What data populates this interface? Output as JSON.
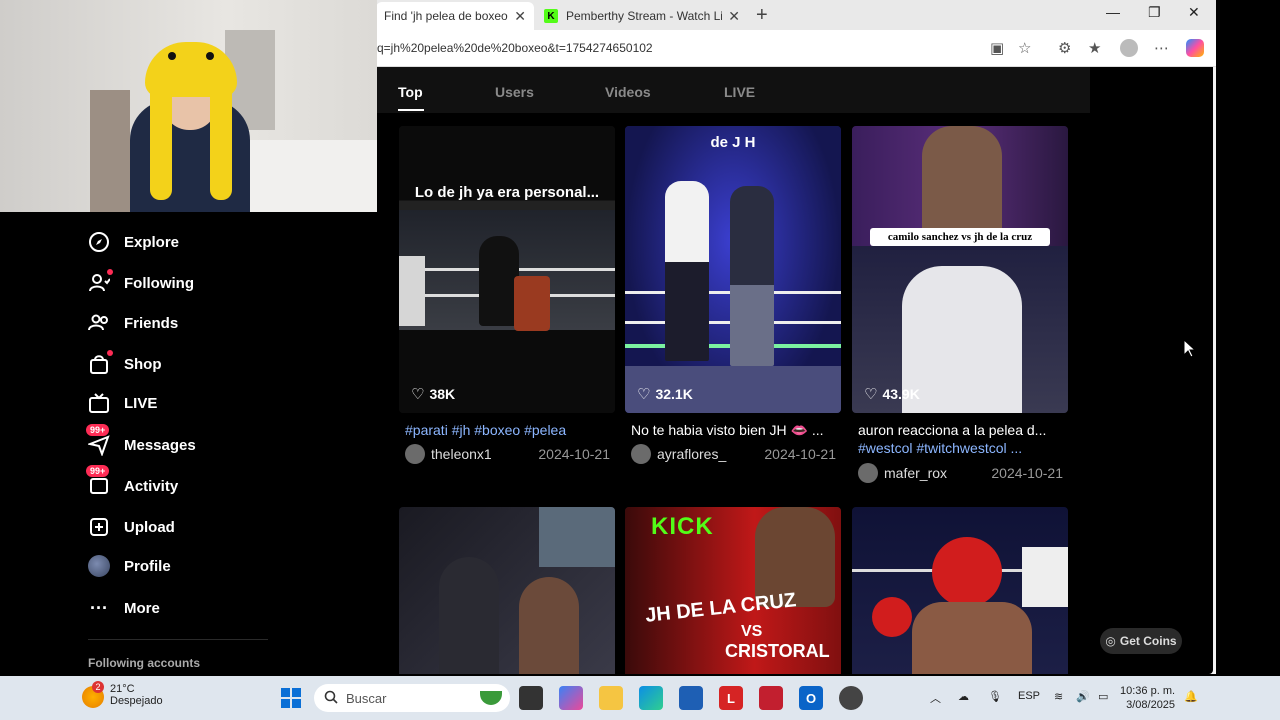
{
  "browser": {
    "tabs": [
      {
        "label": "Find 'jh pelea de boxeo' on"
      },
      {
        "label": "Pemberthy Stream - Watch Live o"
      }
    ],
    "url": "q=jh%20pelea%20de%20boxeo&t=1754274650102"
  },
  "sidebar": {
    "items": [
      {
        "label": "Explore",
        "icon": "compass-icon"
      },
      {
        "label": "Following",
        "icon": "following-icon"
      },
      {
        "label": "Friends",
        "icon": "friends-icon"
      },
      {
        "label": "Shop",
        "icon": "shop-icon"
      },
      {
        "label": "LIVE",
        "icon": "live-tv-icon"
      },
      {
        "label": "Messages",
        "icon": "messages-icon",
        "badge": "99+"
      },
      {
        "label": "Activity",
        "icon": "activity-icon",
        "badge": "99+"
      },
      {
        "label": "Upload",
        "icon": "upload-icon"
      },
      {
        "label": "Profile",
        "icon": "profile-avatar"
      },
      {
        "label": "More",
        "icon": "more-icon"
      }
    ],
    "following_accounts": "Following accounts"
  },
  "search_tabs": [
    "Top",
    "Users",
    "Videos",
    "LIVE"
  ],
  "results": [
    {
      "overlay": "Lo de jh ya era personal...",
      "likes": "38K",
      "desc": "#parati #jh #boxeo #pelea",
      "user": "theleonx1",
      "date": "2024-10-21"
    },
    {
      "overlay": "de J H",
      "likes": "32.1K",
      "desc": "No te habia visto bien JH 👄 ...",
      "user": "ayraflores_",
      "date": "2024-10-21"
    },
    {
      "overlay": "camilo sanchez vs jh de la cruz",
      "likes": "43.9K",
      "desc": "auron reacciona a la pelea d...",
      "desc2": "#westcol #twitchwestcol ...",
      "user": "mafer_rox",
      "date": "2024-10-21"
    }
  ],
  "row2": [
    {
      "text": ""
    },
    {
      "text": "KICK",
      "text2": "JH DE LA CRUZ",
      "text3": "VS",
      "text4": "CRISTORAL"
    },
    {
      "text": ""
    }
  ],
  "get_coins": "Get Coins",
  "taskbar": {
    "temp": "21°C",
    "weather": "Despejado",
    "weather_badge": "2",
    "search": "Buscar",
    "lang": "ESP",
    "time": "10:36 p. m.",
    "date": "3/08/2025"
  },
  "colors": {
    "accent": "#fe2c55",
    "hashtag": "#8cb6ff",
    "kick": "#53fc18"
  }
}
